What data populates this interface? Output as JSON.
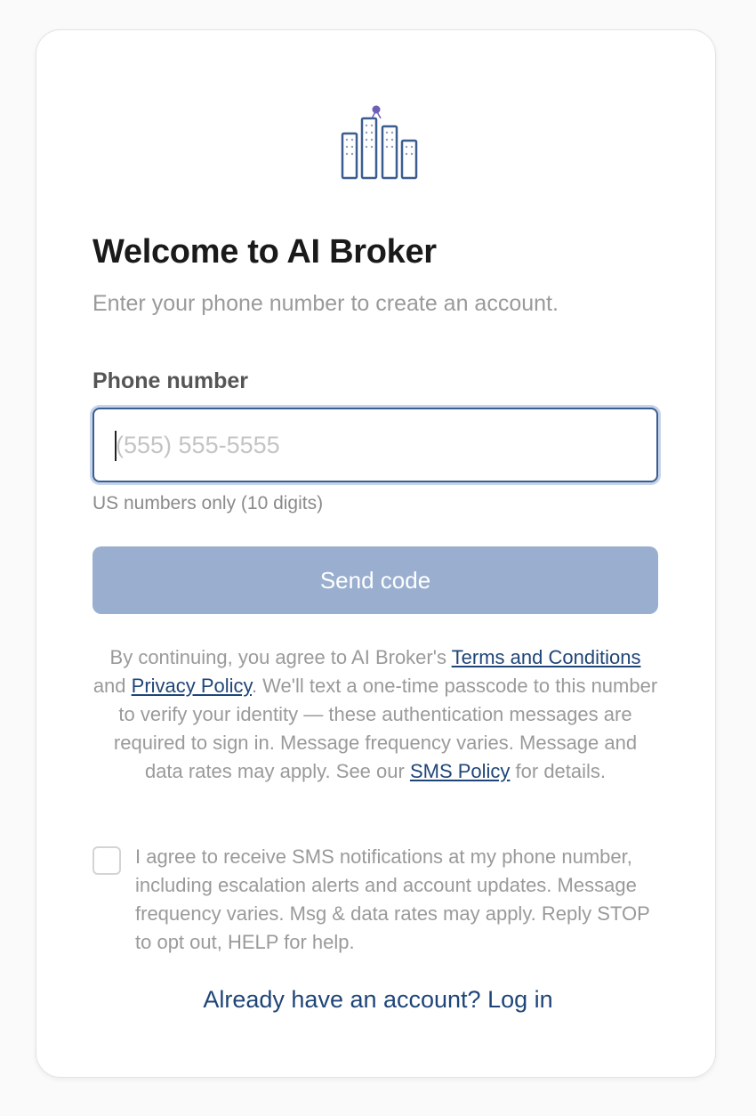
{
  "brand": {
    "logo_icon": "city-buildings-icon",
    "primary_color": "#3b5d8f",
    "accent_color": "#6b5fb8",
    "link_color": "#1f4578"
  },
  "header": {
    "title": "Welcome to AI Broker",
    "subtitle": "Enter your phone number to create an account."
  },
  "form": {
    "phone_label": "Phone number",
    "phone_value": "",
    "phone_placeholder": "(555) 555-5555",
    "phone_helper": "US numbers only (10 digits)",
    "submit_label": "Send code",
    "submit_color": "#9aafcf"
  },
  "legal": {
    "prefix": "By continuing, you agree to AI Broker's ",
    "terms_link": "Terms and Conditions",
    "and_text": " and ",
    "privacy_link": "Privacy Policy",
    "middle": ". We'll text a one-time passcode to this number to verify your identity — these authentication messages are required to sign in. Message frequency varies. Message and data rates may apply. See our ",
    "sms_link": "SMS Policy",
    "suffix": " for details."
  },
  "consent": {
    "checked": false,
    "text": "I agree to receive SMS notifications at my phone number, including escalation alerts and account updates. Message frequency varies. Msg & data rates may apply. Reply STOP to opt out, HELP for help."
  },
  "footer": {
    "login_link": "Already have an account? Log in"
  }
}
